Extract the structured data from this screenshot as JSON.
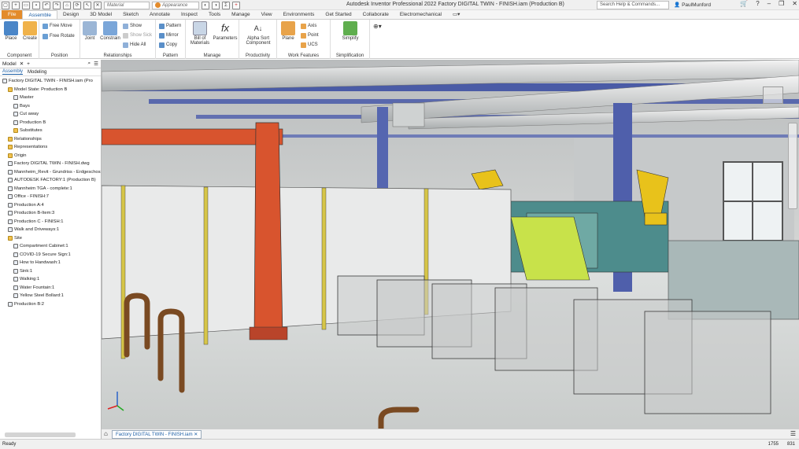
{
  "app_title": "Autodesk Inventor Professional 2022    Factory DIGITAL TWIN - FINISH.iam (Production B)",
  "qat": {
    "material": "Material",
    "appearance": "Appearance"
  },
  "help_search": "Search Help & Commands...",
  "user": "PaulMunford",
  "tabs": [
    "File",
    "Assemble",
    "Design",
    "3D Model",
    "Sketch",
    "Annotate",
    "Inspect",
    "Tools",
    "Manage",
    "View",
    "Environments",
    "Get Started",
    "Collaborate",
    "Electromechanical"
  ],
  "ribbon": {
    "component": {
      "label": "Component",
      "place": "Place",
      "create": "Create"
    },
    "position": {
      "label": "Position",
      "free_move": "Free Move",
      "free_rotate": "Free Rotate"
    },
    "relationships": {
      "label": "Relationships",
      "joint": "Joint",
      "constrain": "Constrain",
      "show": "Show",
      "show_sick": "Show Sick",
      "hide_all": "Hide All"
    },
    "pattern": {
      "label": "Pattern",
      "pattern": "Pattern",
      "mirror": "Mirror",
      "copy": "Copy"
    },
    "manage": {
      "label": "Manage",
      "bom": "Bill of Materials",
      "parameters": "Parameters"
    },
    "productivity": {
      "label": "Productivity",
      "alpha_sort": "Alpha Sort Component"
    },
    "work_features": {
      "label": "Work Features",
      "plane": "Plane",
      "axis": "Axis",
      "point": "Point",
      "ucs": "UCS"
    },
    "simplification": {
      "label": "Simplification",
      "simplify": "Simplify"
    }
  },
  "browser": {
    "title": "Model",
    "tabs": [
      "Assembly",
      "Modeling"
    ],
    "items": [
      {
        "label": "Factory DIGITAL TWIN - FINISH.iam (Pro",
        "indent": 0,
        "type": "asm"
      },
      {
        "label": "Model State: Production B",
        "indent": 1,
        "type": "fold"
      },
      {
        "label": "Master",
        "indent": 2,
        "type": "asm"
      },
      {
        "label": "Bays",
        "indent": 2,
        "type": "asm"
      },
      {
        "label": "Cut away",
        "indent": 2,
        "type": "asm"
      },
      {
        "label": "Production B",
        "indent": 2,
        "type": "asm"
      },
      {
        "label": "Substitutes",
        "indent": 2,
        "type": "fold"
      },
      {
        "label": "Relationships",
        "indent": 1,
        "type": "fold"
      },
      {
        "label": "Representations",
        "indent": 1,
        "type": "fold"
      },
      {
        "label": "Origin",
        "indent": 1,
        "type": "fold"
      },
      {
        "label": "Factory DIGITAL TWIN - FINISH.dwg",
        "indent": 1,
        "type": "asm"
      },
      {
        "label": "Mannheim_Revit - Grundriss - Erdgeschoss",
        "indent": 1,
        "type": "asm"
      },
      {
        "label": "AUTODESK FACTORY:1 (Production B)",
        "indent": 1,
        "type": "asm"
      },
      {
        "label": "Mannheim TGA - complete:1",
        "indent": 1,
        "type": "asm"
      },
      {
        "label": "Office - FINISH:7",
        "indent": 1,
        "type": "asm"
      },
      {
        "label": "Production A:4",
        "indent": 1,
        "type": "asm"
      },
      {
        "label": "Production B-Item:3",
        "indent": 1,
        "type": "asm"
      },
      {
        "label": "Production C - FINISH:1",
        "indent": 1,
        "type": "asm"
      },
      {
        "label": "Walk and Driveways:1",
        "indent": 1,
        "type": "asm"
      },
      {
        "label": "Site",
        "indent": 1,
        "type": "fold"
      },
      {
        "label": "Compartment Cabinet:1",
        "indent": 2,
        "type": "asm"
      },
      {
        "label": "COVID-19 Secure Sign:1",
        "indent": 2,
        "type": "asm"
      },
      {
        "label": "How to Handwash:1",
        "indent": 2,
        "type": "asm"
      },
      {
        "label": "Sink:1",
        "indent": 2,
        "type": "asm"
      },
      {
        "label": "Walking:1",
        "indent": 2,
        "type": "asm"
      },
      {
        "label": "Water Fountain:1",
        "indent": 2,
        "type": "asm"
      },
      {
        "label": "Yellow Steel Bollard:1",
        "indent": 2,
        "type": "asm"
      },
      {
        "label": "Production B:2",
        "indent": 1,
        "type": "asm"
      }
    ]
  },
  "doc_tab": "Factory DIGITAL TWIN - FINISH.iam",
  "status": {
    "left": "Ready",
    "n1": "1755",
    "n2": "831"
  },
  "colors": {
    "file_tab": "#e38b2b",
    "accent": "#1d5fa6",
    "frame_orange": "#d8542e",
    "robot_yellow": "#e8c21b"
  }
}
